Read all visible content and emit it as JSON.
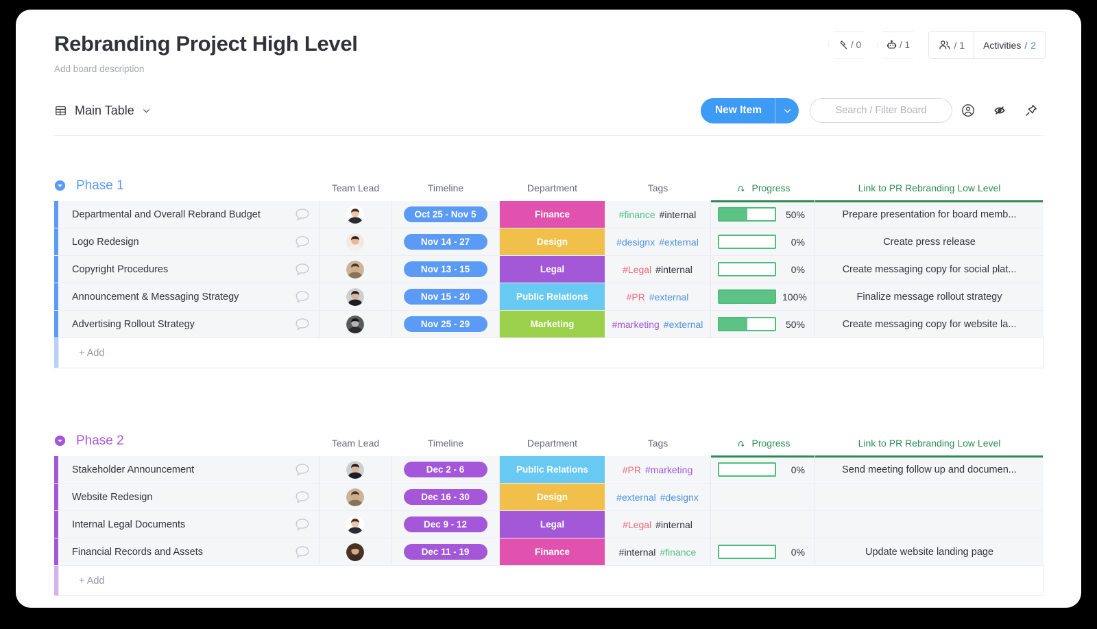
{
  "board": {
    "title": "Rebranding Project High Level",
    "description": "Add board description"
  },
  "header_badges": {
    "integrations": {
      "icon": "integration-icon",
      "count": "/ 0"
    },
    "automations": {
      "icon": "robot-icon",
      "count": "/ 1"
    },
    "members": {
      "icon": "people-icon",
      "count": "/ 1"
    },
    "activities": {
      "label": "Activities",
      "separator": "/",
      "count": "2"
    }
  },
  "toolbar": {
    "view_icon": "table-icon",
    "view_label": "Main Table",
    "view_chevron": "chevron-down-icon",
    "new_item_label": "New Item",
    "new_item_chevron": "chevron-down-icon",
    "search_placeholder": "Search / Filter Board",
    "search_value": "",
    "person_icon": "person-circle-icon",
    "hide_icon": "eye-off-icon",
    "pin_icon": "pin-icon"
  },
  "columns": [
    {
      "key": "name",
      "label": ""
    },
    {
      "key": "lead",
      "label": "Team Lead"
    },
    {
      "key": "timeline",
      "label": "Timeline"
    },
    {
      "key": "department",
      "label": "Department"
    },
    {
      "key": "tags",
      "label": "Tags"
    },
    {
      "key": "progress",
      "label": "Progress",
      "icon": "mirror-arrow-icon",
      "connected": true
    },
    {
      "key": "link",
      "label": "Link to PR Rebranding Low Level",
      "connected": true
    }
  ],
  "colors": {
    "accent_blue": "#3d9bf6",
    "group1": "#5c9bf5",
    "group2": "#a457d8",
    "connected_green": "#2d8a54",
    "progress_green": "#5dc285",
    "finance": "#e152ae",
    "design": "#f0c04b",
    "legal": "#a358d8",
    "public_relations": "#68c9f2",
    "marketing": "#9bd14a",
    "tag_green": "#4dc285",
    "tag_blue": "#4d92df",
    "tag_red": "#e8697d",
    "tag_purple": "#a358d8",
    "tag_dark": "#323338"
  },
  "groups": [
    {
      "name": "Phase 1",
      "color": "#5c9bf5",
      "collapse_icon": "chevron-down-circle-icon",
      "add_label": "+ Add",
      "items": [
        {
          "name": "Departmental and Overall Rebrand Budget",
          "comment_icon": "comment-bubble-icon",
          "avatar": "avatar-man-suit",
          "timeline": "Oct 25 - Nov 5",
          "department": "Finance",
          "dept_color": "#e152ae",
          "tags": [
            {
              "text": "#finance",
              "color": "#4dc285"
            },
            {
              "text": "#internal",
              "color": "#323338"
            }
          ],
          "progress": 50,
          "progress_label": "50%",
          "link": "Prepare presentation for board memb..."
        },
        {
          "name": "Logo Redesign",
          "comment_icon": "comment-bubble-icon",
          "avatar": "avatar-woman-dark-hair",
          "timeline": "Nov 14 - 27",
          "department": "Design",
          "dept_color": "#f0c04b",
          "tags": [
            {
              "text": "#designx",
              "color": "#4d92df"
            },
            {
              "text": "#external",
              "color": "#4d92df"
            }
          ],
          "progress": 0,
          "progress_label": "0%",
          "link": "Create press release"
        },
        {
          "name": "Copyright Procedures",
          "comment_icon": "comment-bubble-icon",
          "avatar": "avatar-pug-dog",
          "timeline": "Nov 13 - 15",
          "department": "Legal",
          "dept_color": "#a358d8",
          "tags": [
            {
              "text": "#Legal",
              "color": "#e8697d"
            },
            {
              "text": "#internal",
              "color": "#323338"
            }
          ],
          "progress": 0,
          "progress_label": "0%",
          "link": "Create messaging copy for social plat..."
        },
        {
          "name": "Announcement & Messaging Strategy",
          "comment_icon": "comment-bubble-icon",
          "avatar": "avatar-woman-gray-bg",
          "timeline": "Nov 15 - 20",
          "department": "Public Relations",
          "dept_color": "#68c9f2",
          "tags": [
            {
              "text": "#PR",
              "color": "#e8697d"
            },
            {
              "text": "#external",
              "color": "#4d92df"
            }
          ],
          "progress": 100,
          "progress_label": "100%",
          "link": "Finalize message rollout strategy"
        },
        {
          "name": "Advertising Rollout Strategy",
          "comment_icon": "comment-bubble-icon",
          "avatar": "avatar-woman-bw",
          "timeline": "Nov 25 - 29",
          "department": "Marketing",
          "dept_color": "#9bd14a",
          "tags": [
            {
              "text": "#marketing",
              "color": "#a358d8"
            },
            {
              "text": "#external",
              "color": "#4d92df"
            }
          ],
          "progress": 50,
          "progress_label": "50%",
          "link": "Create messaging copy for website la..."
        }
      ]
    },
    {
      "name": "Phase 2",
      "color": "#a457d8",
      "collapse_icon": "chevron-down-circle-icon",
      "add_label": "+ Add",
      "items": [
        {
          "name": "Stakeholder Announcement",
          "comment_icon": "comment-bubble-icon",
          "avatar": "avatar-woman-gray-bg",
          "timeline": "Dec 2 - 6",
          "department": "Public Relations",
          "dept_color": "#68c9f2",
          "tags": [
            {
              "text": "#PR",
              "color": "#e8697d"
            },
            {
              "text": "#marketing",
              "color": "#a358d8"
            }
          ],
          "progress": 0,
          "progress_label": "0%",
          "link": "Send meeting follow up and documen..."
        },
        {
          "name": "Website Redesign",
          "comment_icon": "comment-bubble-icon",
          "avatar": "avatar-pug-dog",
          "timeline": "Dec 16 - 30",
          "department": "Design",
          "dept_color": "#f0c04b",
          "tags": [
            {
              "text": "#external",
              "color": "#4d92df"
            },
            {
              "text": "#designx",
              "color": "#4d92df"
            }
          ],
          "progress": null,
          "progress_label": "",
          "link": ""
        },
        {
          "name": "Internal Legal Documents",
          "comment_icon": "comment-bubble-icon",
          "avatar": "avatar-man-suit",
          "timeline": "Dec 9 - 12",
          "department": "Legal",
          "dept_color": "#a358d8",
          "tags": [
            {
              "text": "#Legal",
              "color": "#e8697d"
            },
            {
              "text": "#internal",
              "color": "#323338"
            }
          ],
          "progress": null,
          "progress_label": "",
          "link": ""
        },
        {
          "name": "Financial Records and Assets",
          "comment_icon": "comment-bubble-icon",
          "avatar": "avatar-woman-curly",
          "timeline": "Dec 11 - 19",
          "department": "Finance",
          "dept_color": "#e152ae",
          "tags": [
            {
              "text": "#internal",
              "color": "#323338"
            },
            {
              "text": "#finance",
              "color": "#4dc285"
            }
          ],
          "progress": 0,
          "progress_label": "0%",
          "link": "Update website landing page"
        }
      ]
    }
  ]
}
